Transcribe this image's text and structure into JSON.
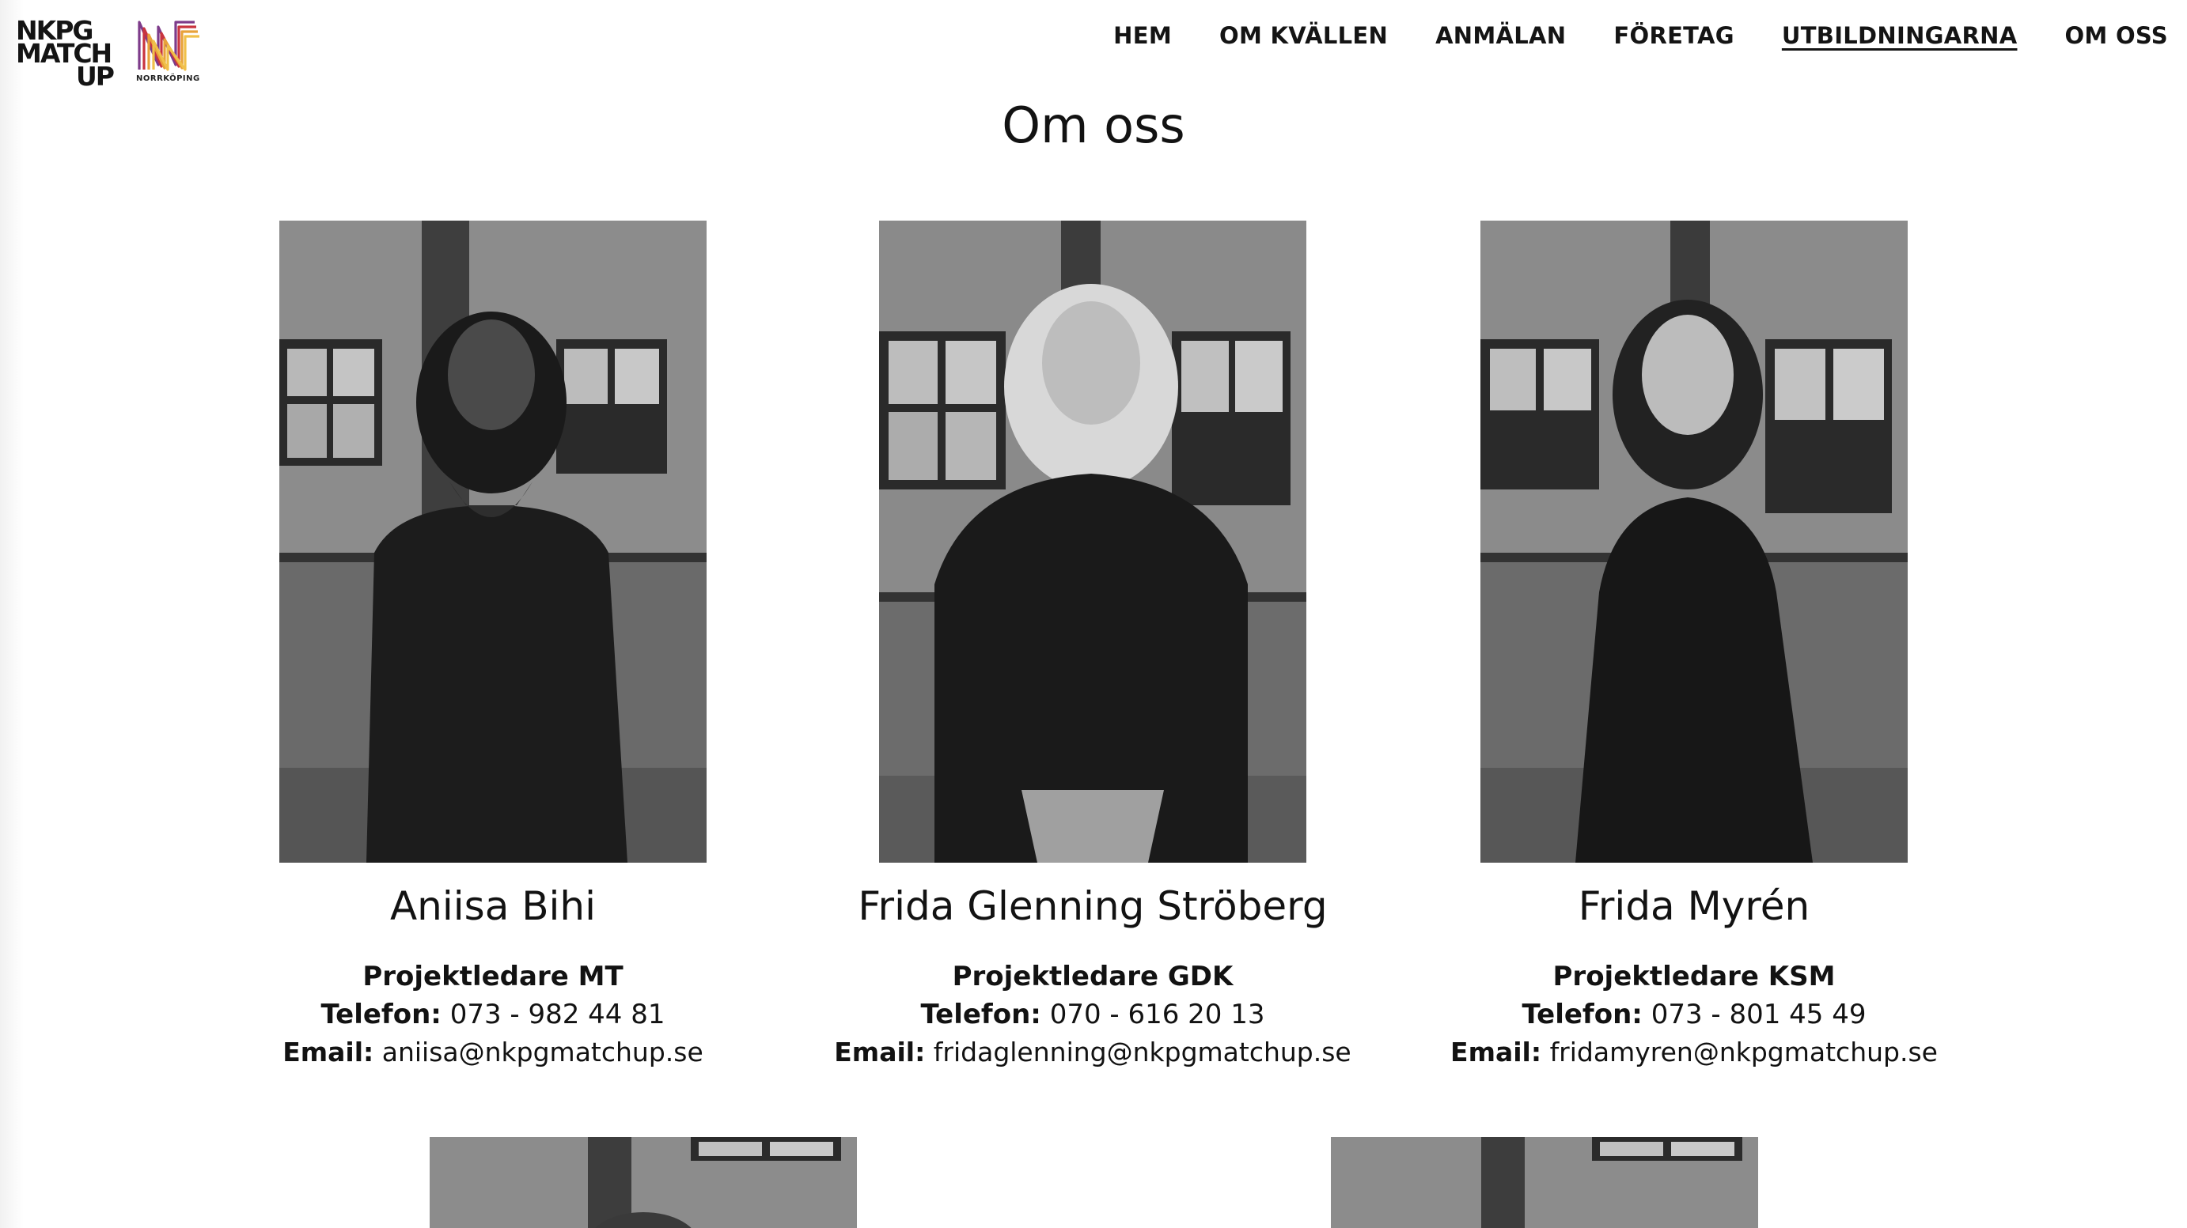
{
  "logo": {
    "lines": [
      "NKPG",
      "MATCH",
      "UP"
    ],
    "city": "NORRKÖPING"
  },
  "nav": {
    "items": [
      {
        "label": "HEM",
        "active": false
      },
      {
        "label": "OM KVÄLLEN",
        "active": false
      },
      {
        "label": "ANMÄLAN",
        "active": false
      },
      {
        "label": "FÖRETAG",
        "active": false
      },
      {
        "label": "UTBILDNINGARNA",
        "active": true
      },
      {
        "label": "OM OSS",
        "active": false
      }
    ]
  },
  "page_title": "Om oss",
  "labels": {
    "phone": "Telefon:",
    "email": "Email:"
  },
  "team": [
    {
      "name": "Aniisa Bihi",
      "role": "Projektledare MT",
      "phone": "073 - 982 44 81",
      "email": "aniisa@nkpgmatchup.se"
    },
    {
      "name": "Frida Glenning Ströberg",
      "role": "Projektledare GDK",
      "phone": "070 - 616 20 13",
      "email": "fridaglenning@nkpgmatchup.se"
    },
    {
      "name": "Frida Myrén",
      "role": "Projektledare KSM",
      "phone": "073 - 801 45 49",
      "email": "fridamyren@nkpgmatchup.se"
    }
  ],
  "colors": {
    "text": "#121212",
    "logo_orange": "#e8a23a",
    "logo_red": "#c8343f",
    "logo_purple": "#7d3b8a",
    "photo_wall": "#8a8a8a",
    "photo_dark": "#1c1c1c"
  }
}
